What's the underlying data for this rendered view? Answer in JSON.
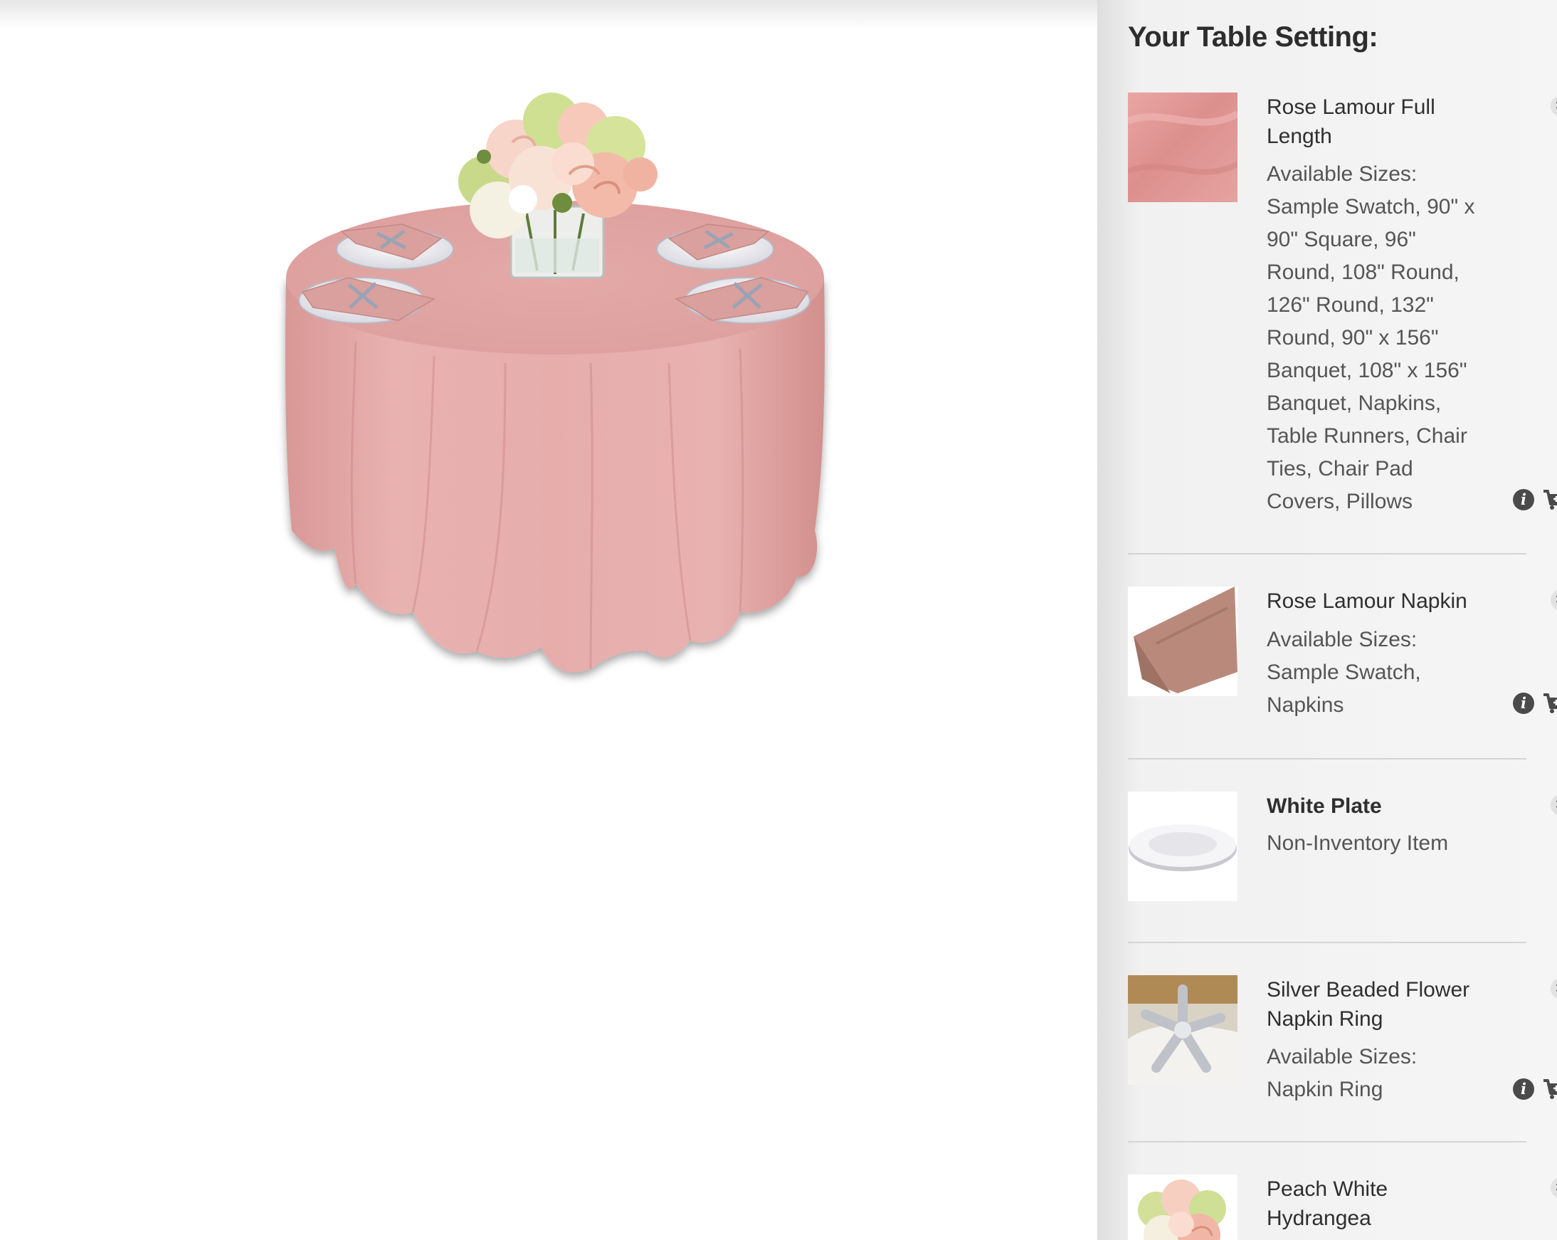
{
  "sidebar": {
    "title": "Your Table Setting:",
    "remove_symbol": "✖",
    "info_symbol": "i",
    "items": [
      {
        "name": "Rose Lamour Full Length",
        "sizes": "Available Sizes: Sample Swatch, 90\" x 90\" Square, 96\" Round, 108\" Round, 126\" Round, 132\" Round, 90\" x 156\" Banquet, 108\" x 156\" Banquet, Napkins, Table Runners, Chair Ties, Chair Pad Covers, Pillows",
        "thumb": "tablecloth-swatch"
      },
      {
        "name": "Rose Lamour Napkin",
        "sizes": "Available Sizes: Sample Swatch, Napkins",
        "thumb": "napkin"
      },
      {
        "name": "White Plate",
        "sizes": "Non-Inventory Item",
        "thumb": "plate"
      },
      {
        "name": "Silver Beaded Flower Napkin Ring",
        "sizes": "Available Sizes: Napkin Ring",
        "thumb": "napkin-ring"
      },
      {
        "name": "Peach White Hydrangea",
        "sizes": "",
        "thumb": "hydrangea"
      }
    ]
  },
  "colors": {
    "tablecloth": "#e2a9a8",
    "napkin": "#b8897a",
    "sidebar_bg": "#f3f3f3",
    "icon_dark": "#4a4a4a"
  }
}
